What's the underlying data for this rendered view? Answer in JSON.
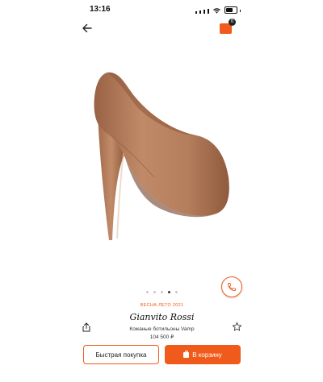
{
  "status_bar": {
    "time": "13:16"
  },
  "header": {
    "cart_count": "0"
  },
  "product": {
    "season": "ВЕСНА-ЛЕТО 2021",
    "brand": "Gianvito Rossi",
    "name": "Кожаные ботильоны Vamp",
    "price": "104 500 ₽"
  },
  "gallery": {
    "total": 5,
    "active": 4
  },
  "buttons": {
    "quick_buy": "Быстрая покупка",
    "add_to_cart": "В корзину"
  },
  "colors": {
    "accent": "#f05a1a",
    "shoe": "#b47d5c"
  },
  "icons": [
    "back-arrow-icon",
    "cart-icon",
    "phone-icon",
    "share-icon",
    "star-icon",
    "bag-icon"
  ]
}
